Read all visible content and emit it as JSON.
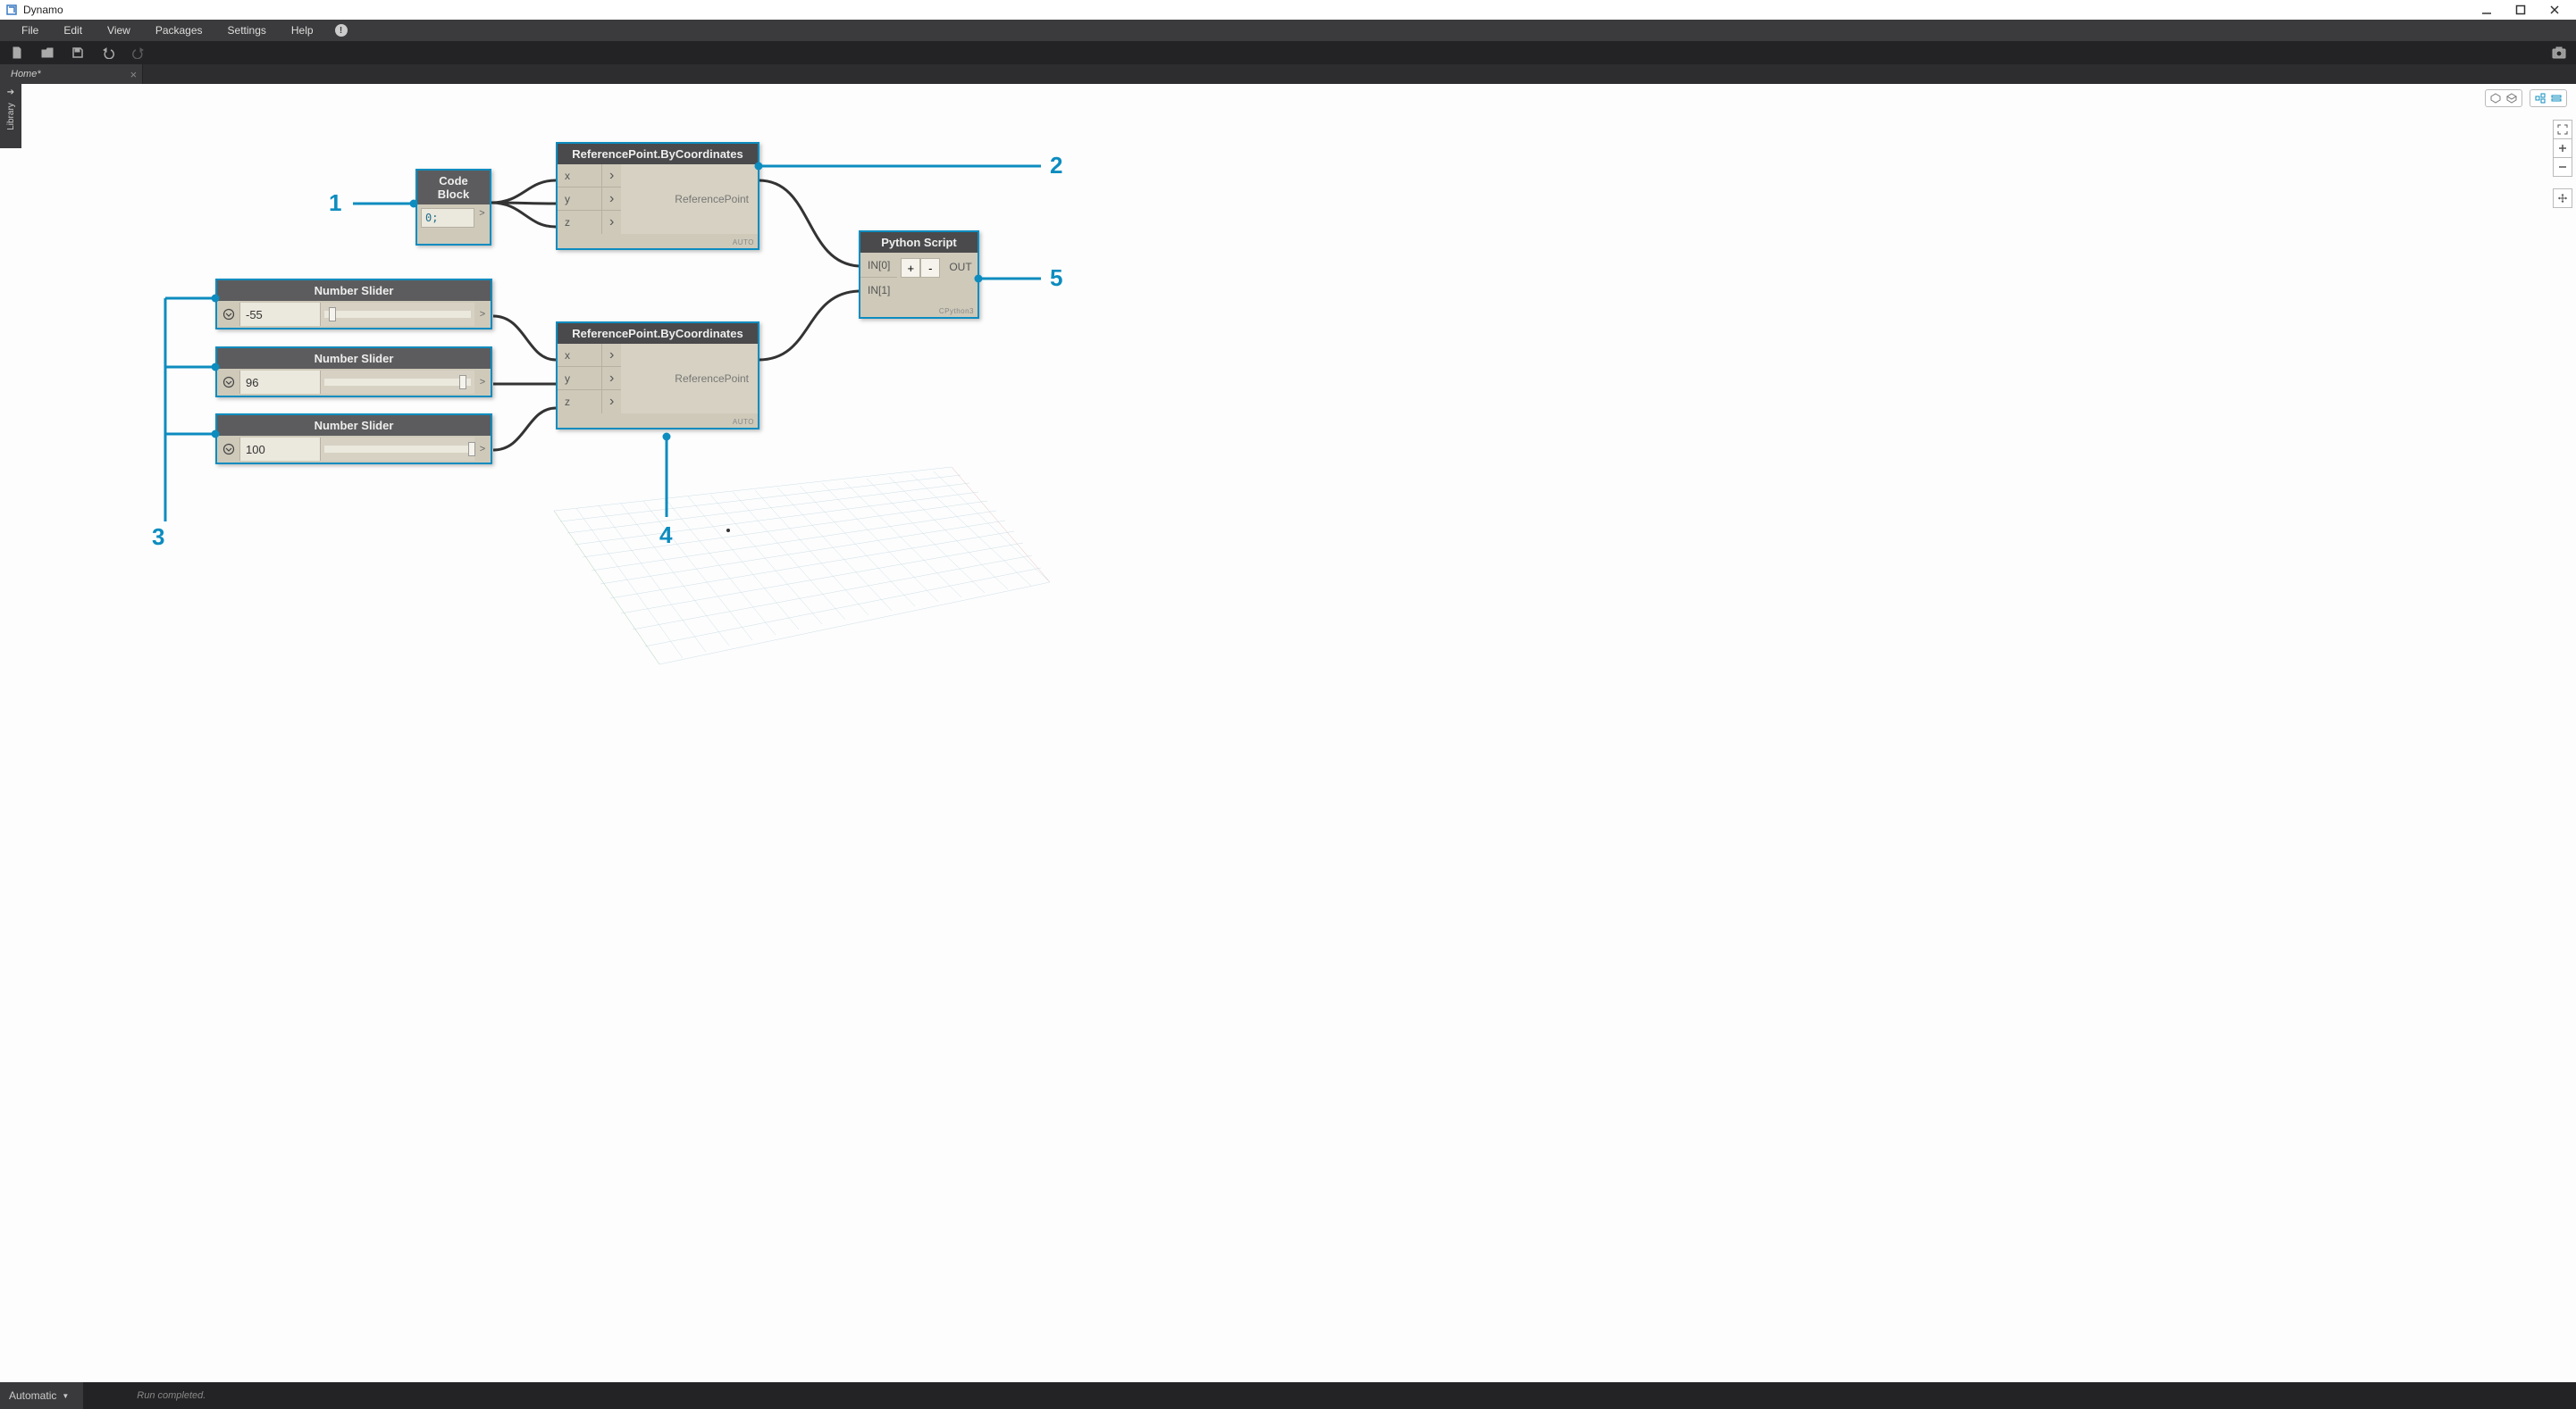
{
  "titlebar": {
    "title": "Dynamo"
  },
  "menu": {
    "items": [
      "File",
      "Edit",
      "View",
      "Packages",
      "Settings",
      "Help"
    ]
  },
  "tabs": {
    "active": "Home*"
  },
  "library": {
    "label": "Library"
  },
  "statusbar": {
    "runmode": "Automatic",
    "status": "Run completed."
  },
  "annotations": {
    "n1": "1",
    "n2": "2",
    "n3": "3",
    "n4": "4",
    "n5": "5"
  },
  "nodes": {
    "codeblock": {
      "title": "Code Block",
      "value": "0;",
      "out": ">"
    },
    "refpoint": {
      "title": "ReferencePoint.ByCoordinates",
      "in": [
        "x",
        "y",
        "z"
      ],
      "out": "ReferencePoint",
      "badge": "AUTO"
    },
    "slider1": {
      "title": "Number Slider",
      "value": "-55",
      "out": ">",
      "thumb_pct": 3
    },
    "slider2": {
      "title": "Number Slider",
      "value": "96",
      "out": ">",
      "thumb_pct": 92
    },
    "slider3": {
      "title": "Number Slider",
      "value": "100",
      "out": ">",
      "thumb_pct": 98
    },
    "python": {
      "title": "Python Script",
      "in": [
        "IN[0]",
        "IN[1]"
      ],
      "add": "+",
      "remove": "-",
      "out": "OUT",
      "badge": "CPython3"
    }
  }
}
